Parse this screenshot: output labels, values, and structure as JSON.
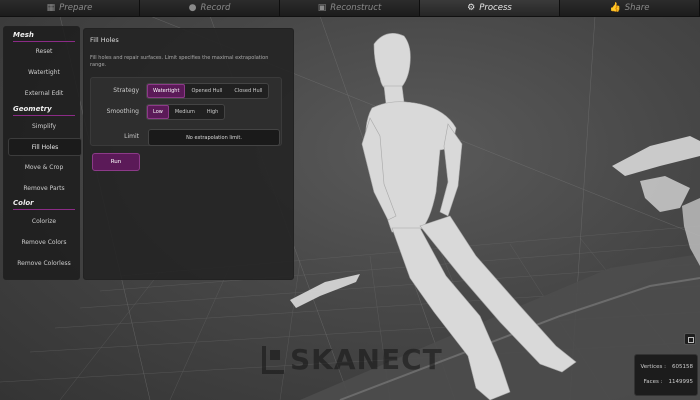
{
  "workflow": {
    "steps": [
      {
        "label": "Prepare",
        "icon": "▦"
      },
      {
        "label": "Record",
        "icon": "●"
      },
      {
        "label": "Reconstruct",
        "icon": "▣"
      },
      {
        "label": "Process",
        "icon": "⚙"
      },
      {
        "label": "Share",
        "icon": "👍"
      }
    ],
    "active": "Process"
  },
  "sidebar": {
    "sections": [
      {
        "title": "Mesh",
        "items": [
          "Reset",
          "Watertight",
          "External Edit"
        ]
      },
      {
        "title": "Geometry",
        "items": [
          "Simplify",
          "Fill Holes",
          "Move & Crop",
          "Remove Parts"
        ]
      },
      {
        "title": "Color",
        "items": [
          "Colorize",
          "Remove Colors",
          "Remove Colorless"
        ]
      }
    ],
    "selected": "Fill Holes"
  },
  "panel": {
    "title": "Fill Holes",
    "description": "Fill holes and repair surfaces. Limit specifies the maximal extrapolation range.",
    "strategy": {
      "label": "Strategy",
      "options": [
        "Watertight",
        "Opened Hull",
        "Closed Hull"
      ],
      "selected": "Watertight"
    },
    "smoothing": {
      "label": "Smoothing",
      "options": [
        "Low",
        "Medium",
        "High"
      ],
      "selected": "Low"
    },
    "limit": {
      "label": "Limit",
      "value": "No extrapolation limit."
    },
    "run_label": "Run"
  },
  "stats": {
    "vertices_label": "Vertices :",
    "vertices": "605158",
    "faces_label": "Faces :",
    "faces": "1149995"
  },
  "watermark": "SKANECT",
  "colors": {
    "accent": "#5b1a58",
    "accent_border": "#8c3a88",
    "section_line": "#8b2b86"
  }
}
